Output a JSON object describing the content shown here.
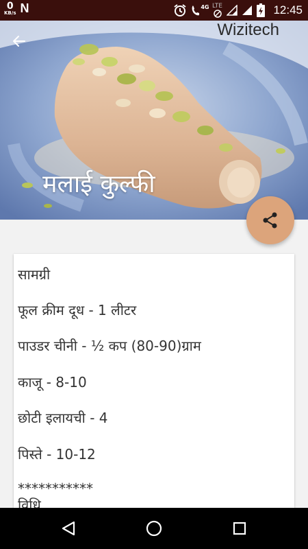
{
  "status_bar": {
    "net_speed_value": "0",
    "net_speed_unit": "KB/s",
    "app_logo": "N",
    "network_type": "4G",
    "lte_label": "LTE",
    "time": "12:45"
  },
  "hero": {
    "watermark": "Wizitech",
    "title": "मलाई कुल्फी"
  },
  "recipe": {
    "lines": [
      "सामग्री",
      "फूल क्रीम दूध - 1 लीटर",
      "पाउडर चीनी - ½ कप (80-90)ग्राम",
      "काजू - 8-10",
      "छोटी इलायची - 4",
      "पिस्ते - 10-12",
      "***********",
      "विधि"
    ]
  },
  "colors": {
    "status_bar_bg": "#3a0f0c",
    "fab_bg": "#dca47b",
    "page_bg": "#f2f2f2",
    "nav_bg": "#000000"
  },
  "icons": {
    "back": "arrow-left-icon",
    "share": "share-icon",
    "nav_back": "triangle-back-icon",
    "nav_home": "circle-home-icon",
    "nav_recents": "square-recents-icon"
  }
}
